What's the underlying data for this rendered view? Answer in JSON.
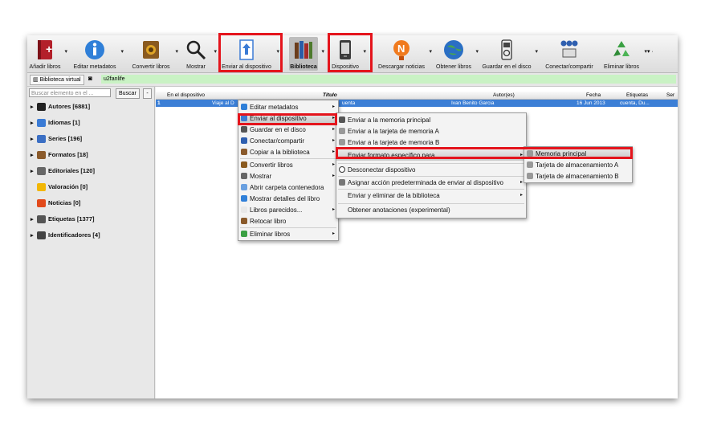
{
  "toolbar": {
    "add_books": "Añadir libros",
    "edit_metadata": "Editar metadatos",
    "convert_books": "Convertir libros",
    "view": "Mostrar",
    "send_to_device": "Enviar al dispositivo",
    "library": "Biblioteca",
    "device": "Dispositivo",
    "fetch_news": "Descargar noticias",
    "get_books": "Obtener libros",
    "save_to_disk": "Guardar en el disco",
    "connect_share": "Conectar/compartir",
    "remove_books": "Eliminar libros"
  },
  "bar2": {
    "virtual_library": "Biblioteca virtual",
    "saved_search": "u2fanlife"
  },
  "search": {
    "placeholder": "Buscar elemento en el ...",
    "button": "Buscar",
    "clear": "-"
  },
  "sidebar": {
    "items": [
      {
        "label": "Autores [6881]",
        "color": "#222222"
      },
      {
        "label": "Idiomas [1]",
        "color": "#3a7bd5"
      },
      {
        "label": "Series [196]",
        "color": "#3b6fc4"
      },
      {
        "label": "Formatos [18]",
        "color": "#8a5a2b"
      },
      {
        "label": "Editoriales [120]",
        "color": "#666666"
      },
      {
        "label": "Valoración [0]",
        "color": "#f2b705"
      },
      {
        "label": "Noticias [0]",
        "color": "#e24a1b"
      },
      {
        "label": "Etiquetas [1377]",
        "color": "#555555"
      },
      {
        "label": "Identificadores [4]",
        "color": "#444444"
      }
    ]
  },
  "table": {
    "headers": [
      "En el dispositivo",
      "Título",
      "Autor(es)",
      "Fecha",
      "Etiquetas",
      "Ser"
    ],
    "row": {
      "title": "Viaje al D",
      "title_tail": "uenta",
      "author": "Ivan Benito Garcia",
      "date": "16 Jun 2013",
      "tags": "cuenta, Du..."
    }
  },
  "menu1": [
    "Editar metadatos",
    "Enviar al dispositivo",
    "Guardar en el disco",
    "Conectar/compartir",
    "Copiar a la biblioteca",
    "Convertir libros",
    "Mostrar",
    "Abrir carpeta contenedora",
    "Mostrar detalles del libro",
    "Libros parecidos...",
    "Retocar libro",
    "Eliminar libros"
  ],
  "menu2": [
    "Enviar a la memoria principal",
    "Enviar a la tarjeta de memoria A",
    "Enviar a la tarjeta de memoria B",
    "Enviar formato específico para",
    "Desconectar dispositivo",
    "Asignar acción predeterminada de enviar al dispositivo",
    "Enviar y eliminar de la biblioteca",
    "Obtener anotaciones (experimental)"
  ],
  "menu3": [
    "Memoria principal",
    "Tarjeta de almacenamiento A",
    "Tarjeta de almacenamiento B"
  ],
  "colors": {
    "highlight": "#e4141c",
    "selection": "#3c7fd6",
    "virtual_bar": "#c9f2c4"
  }
}
